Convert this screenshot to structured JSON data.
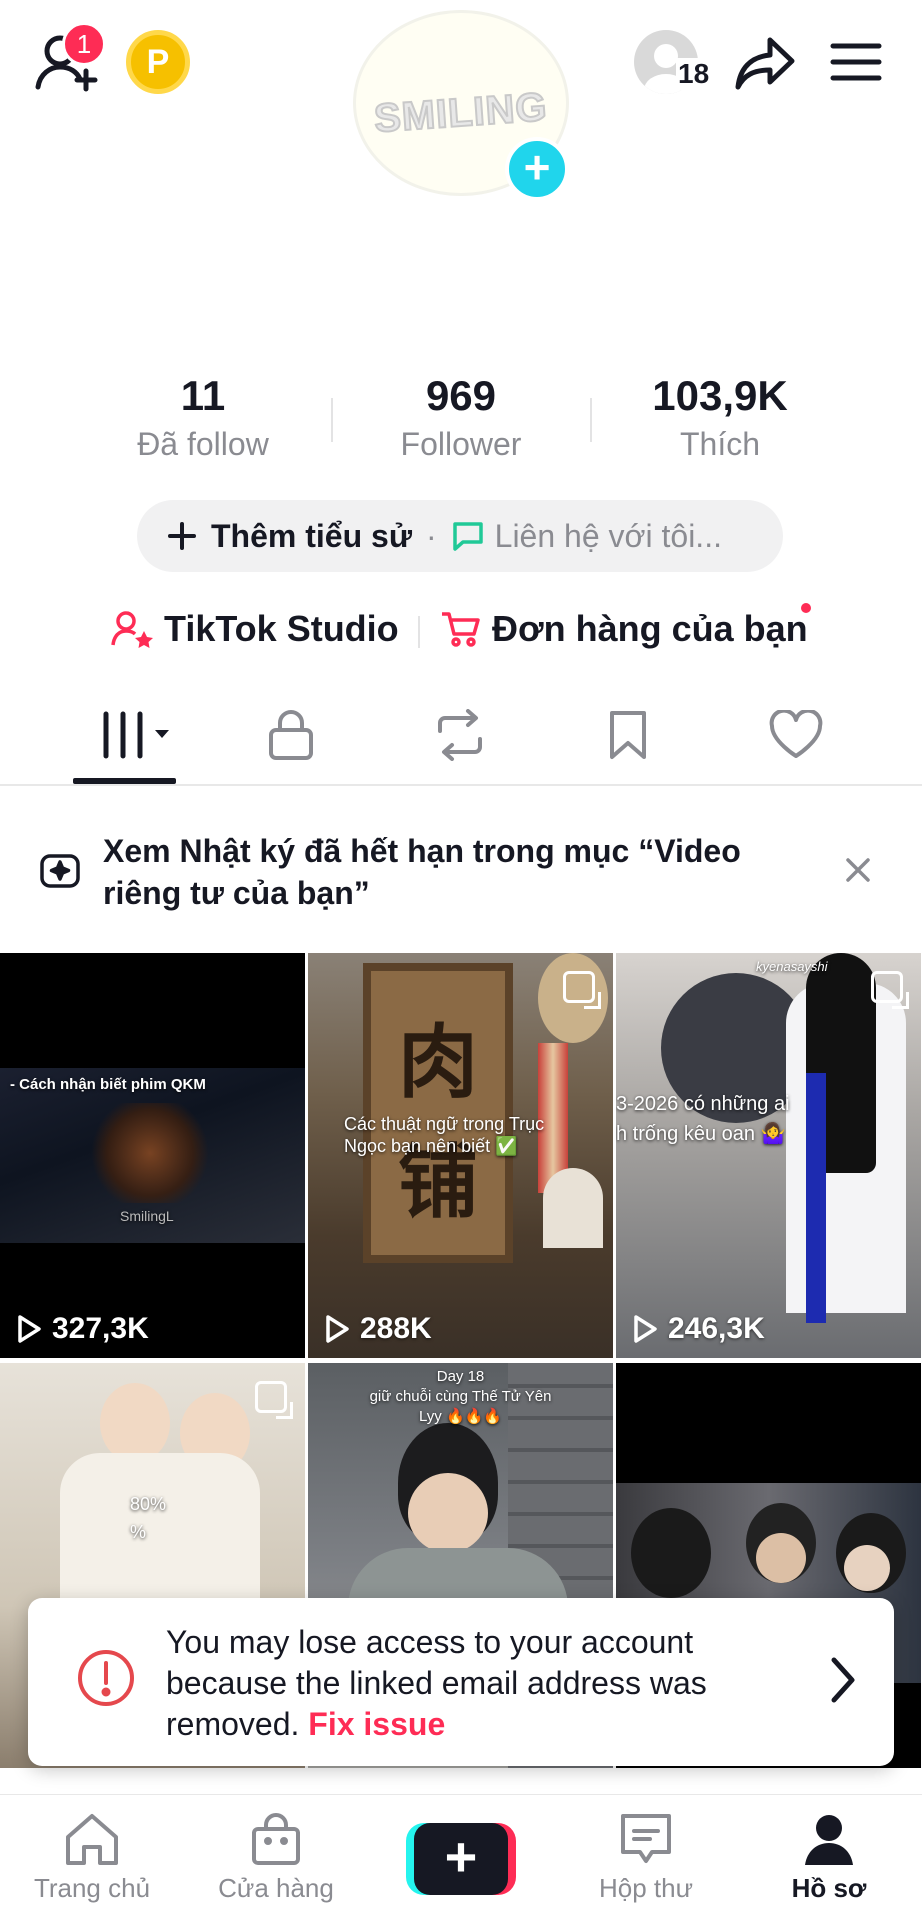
{
  "header": {
    "notification_count": "1",
    "coin_letter": "P",
    "avatar_text": "SMILING",
    "viewer_count": "18"
  },
  "stats": [
    {
      "value": "11",
      "label": "Đã follow"
    },
    {
      "value": "969",
      "label": "Follower"
    },
    {
      "value": "103,9K",
      "label": "Thích"
    }
  ],
  "bio": {
    "add_label": "Thêm tiểu sử",
    "separator": "·",
    "contact_label": "Liên hệ với tôi..."
  },
  "links": {
    "studio": "TikTok Studio",
    "orders": "Đơn hàng của bạn"
  },
  "notice": {
    "text": "Xem Nhật ký đã hết hạn trong mục “Video riêng tư của bạn”"
  },
  "videos": [
    {
      "views": "327,3K",
      "caption": "- Cách nhận biết phim QKM",
      "watermark": "SmilingL"
    },
    {
      "views": "288K",
      "caption": "Các thuật ngữ trong Trục Ngọc bạn nên biết ✅"
    },
    {
      "views": "246,3K",
      "caption": "3-2026 có những ai\nh trống kêu oan 🤷‍♀️",
      "watermark": "kyenasayshi"
    },
    {
      "views": "",
      "caption": "80%\n%"
    },
    {
      "views": "",
      "caption": "Day 18\ngiữ chuỗi cùng Thế Tử Yên\nLyy 🔥🔥🔥"
    },
    {
      "views": "",
      "caption": ""
    }
  ],
  "toast": {
    "message": "You may lose access to your account because the linked email address was removed.",
    "action": "Fix issue"
  },
  "nav": {
    "home": "Trang chủ",
    "shop": "Cửa hàng",
    "create": "+",
    "inbox": "Hộp thư",
    "profile": "Hồ sơ"
  },
  "colors": {
    "accent": "#fe2c55",
    "cyan": "#25f4ee",
    "text": "#161823",
    "muted": "#8a8b91"
  }
}
